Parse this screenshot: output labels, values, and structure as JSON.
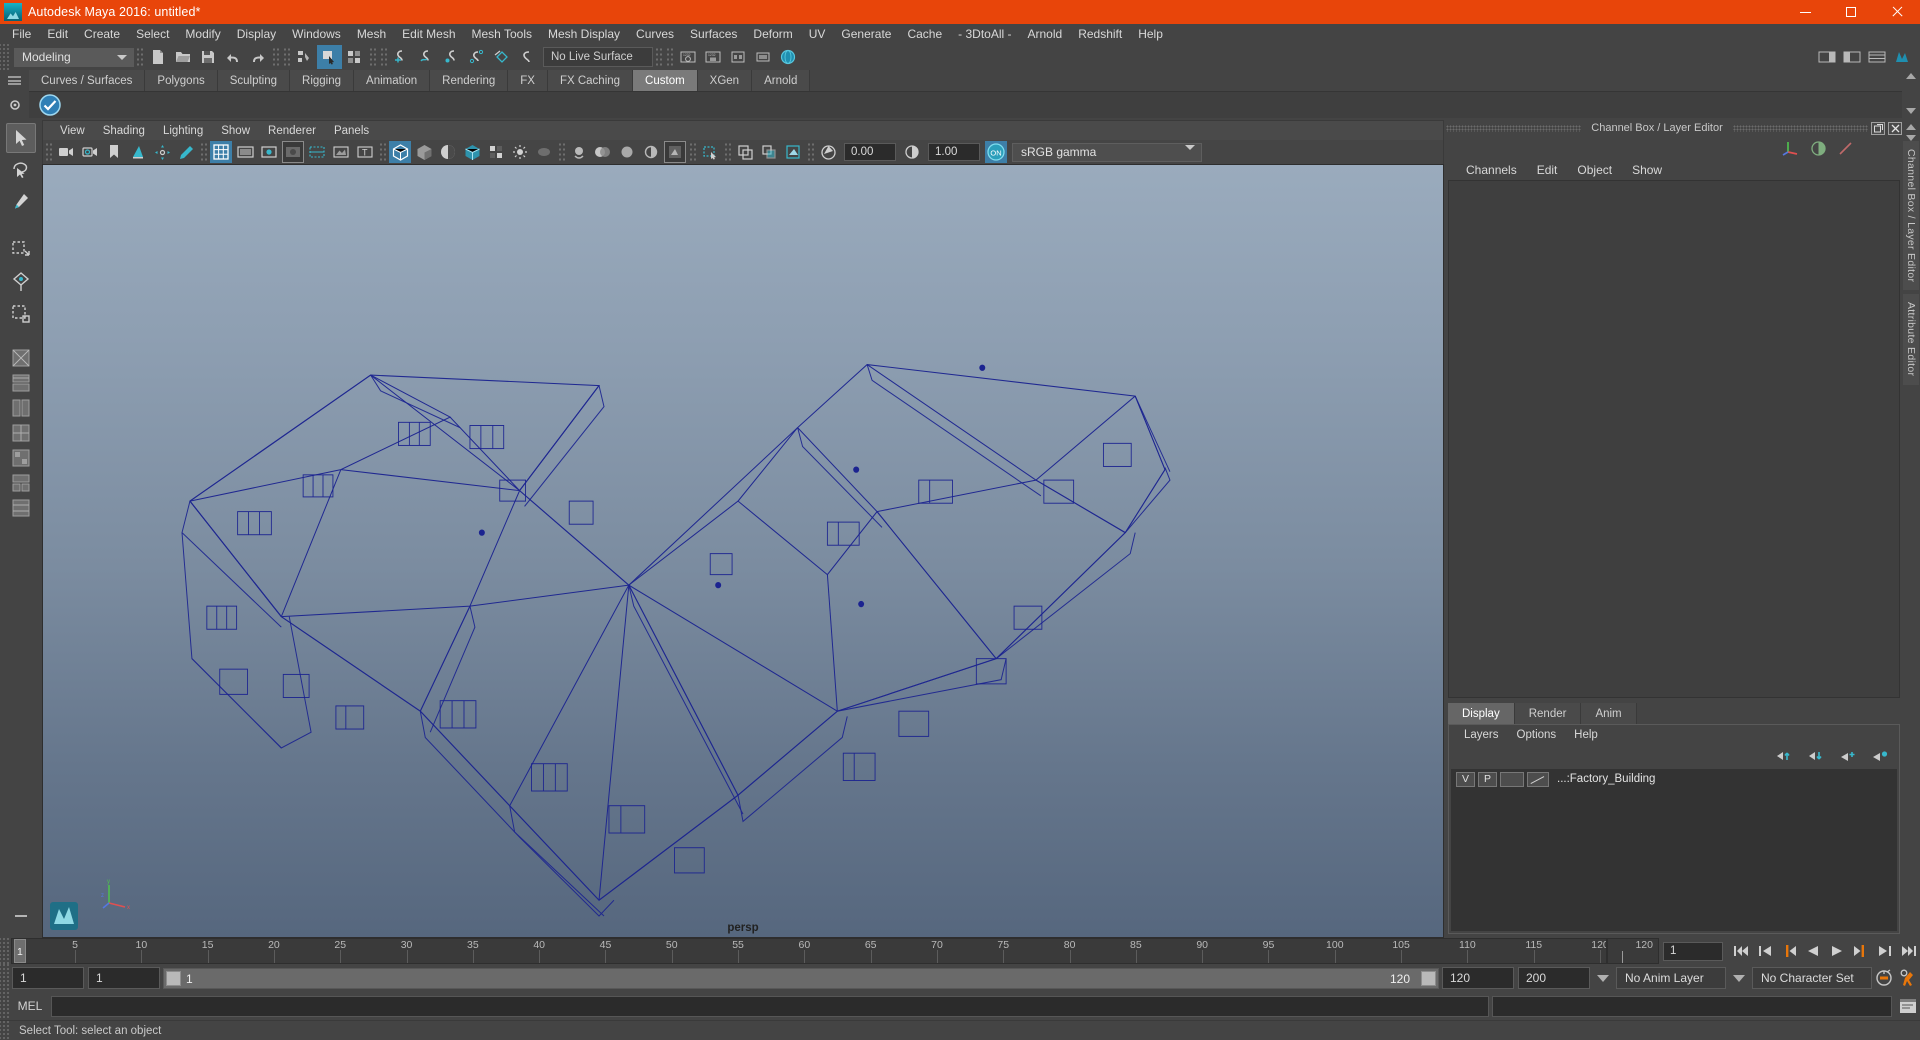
{
  "window": {
    "title": "Autodesk Maya 2016: untitled*",
    "logo_icon": "maya-logo-icon",
    "minimize_label": "Minimize",
    "maximize_label": "Maximize",
    "close_label": "Close"
  },
  "menubar": {
    "items": [
      "File",
      "Edit",
      "Create",
      "Select",
      "Modify",
      "Display",
      "Windows",
      "Mesh",
      "Edit Mesh",
      "Mesh Tools",
      "Mesh Display",
      "Curves",
      "Surfaces",
      "Deform",
      "UV",
      "Generate",
      "Cache",
      "- 3DtoAll -",
      "Arnold",
      "Redshift",
      "Help"
    ]
  },
  "statusbar": {
    "mode": "Modeling",
    "live_surface": "No Live Surface",
    "icons": [
      "new-scene-icon",
      "open-scene-icon",
      "save-scene-icon",
      "undo-icon",
      "redo-icon",
      "select-by-hierarchy-icon",
      "select-by-object-icon",
      "select-by-component-icon",
      "snap-to-grid-icon",
      "snap-to-curve-icon",
      "snap-to-point-icon",
      "snap-to-projected-center-icon",
      "snap-to-view-plane-icon",
      "make-live-icon"
    ],
    "right_icons": [
      "show-hide-editor-icon",
      "attribute-editor-icon",
      "tool-settings-icon",
      "channel-box-icon"
    ]
  },
  "shelf": {
    "tabs": [
      "Curves / Surfaces",
      "Polygons",
      "Sculpting",
      "Rigging",
      "Animation",
      "Rendering",
      "FX",
      "FX Caching",
      "Custom",
      "XGen",
      "Arnold"
    ],
    "active_tab": "Custom",
    "hamburger_icon": "shelf-menu-icon",
    "gear_icon": "shelf-options-icon",
    "buttons": [
      "custom-shelf-button-1"
    ]
  },
  "toolbox": {
    "tools": [
      {
        "name": "select-tool-icon",
        "active": true
      },
      {
        "name": "lasso-select-tool-icon",
        "active": false
      },
      {
        "name": "paint-select-tool-icon",
        "active": false
      },
      {
        "name": "move-tool-icon",
        "active": false
      },
      {
        "name": "rotate-tool-icon",
        "active": false
      },
      {
        "name": "scale-tool-icon",
        "active": false
      }
    ],
    "layout_tools": [
      "layout-single-icon",
      "layout-four-view-icon",
      "layout-persp-outliner-icon",
      "layout-persp-graph-icon",
      "layout-hypershade-icon",
      "layout-persp-uv-icon",
      "layout-two-stacked-icon"
    ],
    "bottom_icon": "minimize-toolbox-icon"
  },
  "viewport": {
    "menus": [
      "View",
      "Shading",
      "Lighting",
      "Show",
      "Renderer",
      "Panels"
    ],
    "camera_label": "persp",
    "toolbar": {
      "exposure_value": "0.00",
      "gamma_value": "1.00",
      "color_space": "sRGB gamma",
      "toggle_on_label": "ON",
      "icons": [
        "select-camera-icon",
        "camera-attributes-icon",
        "bookmark-icon",
        "image-plane-icon",
        "2d-pan-zoom-icon",
        "grease-pencil-icon",
        "grid-toggle-icon",
        "film-gate-icon",
        "resolution-gate-icon",
        "gate-mask-icon",
        "field-chart-icon",
        "safe-action-icon",
        "safe-title-icon",
        "wireframe-icon",
        "smooth-shade-icon",
        "shaded-wireframe-icon",
        "hardware-texture-icon",
        "use-default-lighting-icon",
        "shadows-icon",
        "screen-space-ao-icon",
        "motion-blur-icon",
        "multisample-icon",
        "isolate-select-icon",
        "xray-icon",
        "xray-joints-icon",
        "xray-components-icon",
        "exposure-icon",
        "gamma-icon",
        "color-management-icon"
      ]
    },
    "axis_gizmo_labels": [
      "x",
      "y",
      "z"
    ],
    "scene_object": "Factory_Building wireframe"
  },
  "channel_box": {
    "panel_title": "Channel Box / Layer Editor",
    "undock_icon": "undock-icon",
    "close_icon": "close-icon",
    "tool_icons": [
      "manipulator-icon",
      "half-circle-icon",
      "slash-icon"
    ],
    "menus": [
      "Channels",
      "Edit",
      "Object",
      "Show"
    ]
  },
  "layer_editor": {
    "tabs": [
      "Display",
      "Render",
      "Anim"
    ],
    "active_tab": "Display",
    "menus": [
      "Layers",
      "Options",
      "Help"
    ],
    "button_icons": [
      "move-layer-up-icon",
      "move-layer-down-icon",
      "new-layer-icon",
      "new-layer-from-selected-icon"
    ],
    "layers": [
      {
        "visibility": "V",
        "playback": "P",
        "blank": "",
        "template_icon": "layer-template-icon",
        "name": "...:Factory_Building"
      }
    ]
  },
  "right_vtabs": {
    "tabs": [
      "Channel Box / Layer Editor",
      "Attribute Editor"
    ],
    "scroll_up_icon": "scroll-up-icon",
    "scroll_down_icon": "scroll-down-icon"
  },
  "timeline": {
    "current_frame": "1",
    "ticks": [
      5,
      10,
      15,
      20,
      25,
      30,
      35,
      40,
      45,
      50,
      55,
      60,
      65,
      70,
      75,
      80,
      85,
      90,
      95,
      100,
      105,
      110,
      115,
      120
    ],
    "start": 1,
    "end": 120,
    "end_label": "120",
    "key_field_value": "1",
    "playback_icons": [
      "go-to-start-icon",
      "step-back-frame-icon",
      "step-back-key-icon",
      "play-backwards-icon",
      "play-forwards-icon",
      "step-forward-key-icon",
      "step-forward-frame-icon",
      "go-to-end-icon"
    ]
  },
  "range_slider": {
    "anim_start": "1",
    "range_start": "1",
    "bar_start_label": "1",
    "bar_end_label": "120",
    "range_end": "120",
    "anim_end": "200",
    "anim_layer": "No Anim Layer",
    "character_set": "No Character Set",
    "auto_key_icon": "auto-keyframe-icon",
    "anim_prefs_icon": "animation-preferences-icon"
  },
  "command_line": {
    "language_label": "MEL",
    "input_value": "",
    "input_placeholder": "",
    "output_value": "",
    "script_editor_icon": "script-editor-icon"
  },
  "help_line": {
    "text": "Select Tool: select an object"
  },
  "colors": {
    "title_bar": "#e8450a",
    "chrome": "#444444",
    "accent_blue": "#3d7fa8",
    "accent_cyan": "#37b8cc",
    "viewport_top": "#9aabbd",
    "viewport_bottom": "#56677e",
    "wireframe": "#1b1f8c",
    "active_tab": "#7a7a7a"
  }
}
